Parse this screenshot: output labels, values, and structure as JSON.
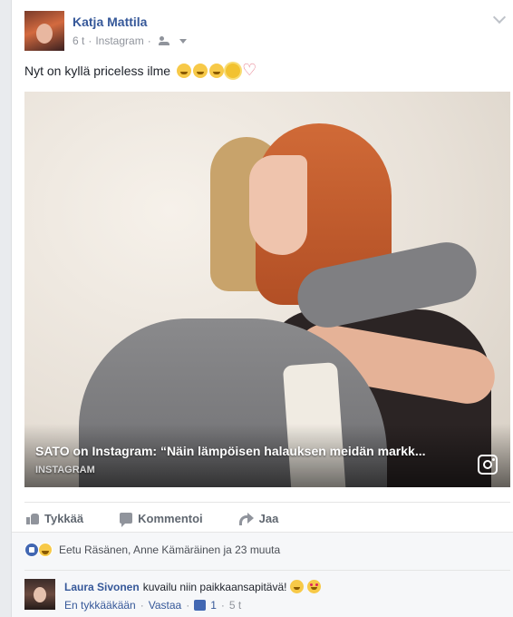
{
  "post": {
    "author": "Katja Mattila",
    "time": "6 t",
    "separator": "·",
    "source": "Instagram",
    "status_text": "Nyt on kyllä priceless ilme",
    "status_emojis": [
      "laughing-emoji",
      "laughing-emoji",
      "laughing-emoji",
      "sun-emoji",
      "heart-emoji"
    ]
  },
  "link": {
    "title": "SATO on Instagram: “Näin lämpöisen halauksen meidän markk...",
    "source": "INSTAGRAM",
    "icon": "instagram-icon"
  },
  "actions": {
    "like": "Tykkää",
    "comment": "Kommentoi",
    "share": "Jaa"
  },
  "reactions": {
    "text": "Eetu Räsänen, Anne Kämäräinen ja 23 muuta",
    "icons": [
      "like-reaction-icon",
      "haha-reaction-icon"
    ]
  },
  "comment": {
    "author": "Laura Sivonen",
    "text": "kuvailu niin paikkaansapitävä!",
    "emojis": [
      "laughing-emoji",
      "heart-eyes-emoji"
    ],
    "like_action": "En tykkääkään",
    "reply_action": "Vastaa",
    "like_count": "1",
    "time": "5 t",
    "separator": "·"
  },
  "colors": {
    "link_blue": "#365899",
    "secondary_text": "#90949c",
    "background": "#e9ebee",
    "like_blue": "#4267b2"
  }
}
